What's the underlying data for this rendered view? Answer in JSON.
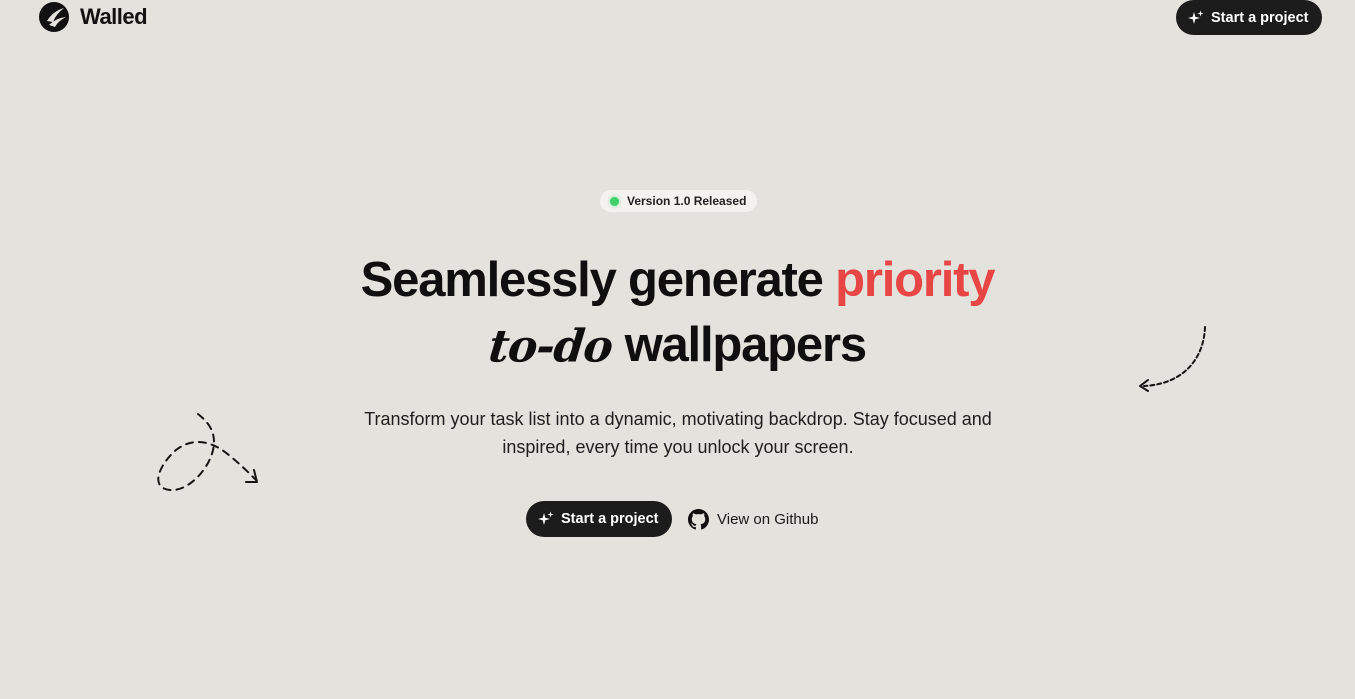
{
  "header": {
    "brand_name": "Walled",
    "logo_icon": "walled-logo-icon",
    "cta_label": "Start a project",
    "cta_icon": "sparkles-icon"
  },
  "hero": {
    "badge_text": "Version 1.0 Released",
    "badge_dot_color": "#3fd06b",
    "headline_part1": "Seamlessly generate",
    "headline_accent": "priority",
    "headline_script": "to-do",
    "headline_part2": "wallpapers",
    "accent_color": "#e84545",
    "subtitle": "Transform your task list into a dynamic, motivating backdrop. Stay focused and inspired, every time you unlock your screen.",
    "primary_cta": "Start a project",
    "secondary_cta": "View on Github",
    "secondary_cta_icon": "github-icon"
  },
  "colors": {
    "background": "#e4e2dd",
    "button": "#1c1c1c",
    "text": "#111111"
  }
}
